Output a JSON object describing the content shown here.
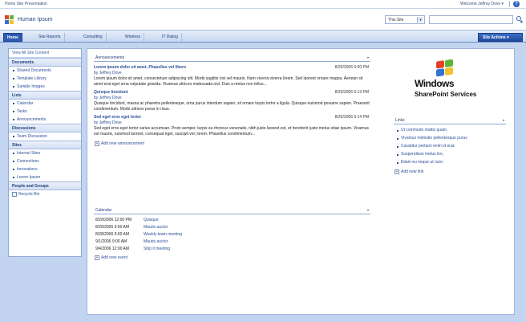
{
  "topbar": {
    "site_link": "Home Site Presentation",
    "welcome": "Welcome Jeffrey Dove ▾"
  },
  "header": {
    "site_title": "Human Ipsum",
    "search_scope": "This Site",
    "search_placeholder": ""
  },
  "nav": {
    "tabs": [
      {
        "label": "Home",
        "active": true
      },
      {
        "label": "Site Reports",
        "active": false
      },
      {
        "label": "Consulting",
        "active": false
      },
      {
        "label": "Wireless",
        "active": false
      },
      {
        "label": "IT Dialog",
        "active": false
      }
    ],
    "site_actions": "Site Actions ▾"
  },
  "leftnav": {
    "view_all": "View All Site Content",
    "sections": [
      {
        "heading": "Documents",
        "items": [
          "Shared Documents",
          "Template Library",
          "Sample Images"
        ]
      },
      {
        "heading": "Lists",
        "items": [
          "Calendar",
          "Tasks",
          "Announcements"
        ]
      },
      {
        "heading": "Discussions",
        "items": [
          "Team Discussion"
        ]
      },
      {
        "heading": "Sites",
        "items": [
          "Internal Sites",
          "Connections",
          "Innovations",
          "Lorem Ipsum"
        ]
      },
      {
        "heading": "People and Groups",
        "items": []
      }
    ],
    "recycle_bin": "Recycle Bin"
  },
  "announcements": {
    "title": "Announcements",
    "menu": "▾",
    "items": [
      {
        "title": "Lorem ipsum dolor sit amet, Phasellus vel libero",
        "date": "8/20/2006 5:00 PM",
        "by": "by Jeffrey Dove",
        "body": "Lorem ipsum dolor sit amet, consectetuer adipiscing elit. Morbi sagittis nisi vel mauris. Nam viverra viverra lorem. Sed laoreet ornare magna. Aenean sit amet erat eget urna vulputate gravida. Vivamus ultrices malesuada nisl. Duis a metus non tellus..."
      },
      {
        "title": "Quisque tincidunt",
        "date": "8/20/2006 5:13 PM",
        "by": "by Jeffrey Dove",
        "body": "Quisque tincidunt, massa ac pharetra pellentesque, urna purus interdum sapien, sit ornare turpis tortor a ligula. Quisque euismod posuere sapien. Praesent condimentum. Morbi ultrices purus in risus."
      },
      {
        "title": "Sed eget eros eget tortor",
        "date": "8/20/2006 5:14 PM",
        "by": "by Jeffrey Dove",
        "body": "Sed eget eros eget tortor varius accumsan. Proin semper, turpis eu rhoncus venenatis, nibh justo laoreet est, et hendrerit justo metus vitae ipsum. Vivamus est mauris, euismod laoreet, consequat eget, suscipit vel, lorem. Phasellus condimentum..."
      }
    ],
    "add_new": "Add new announcement"
  },
  "calendar": {
    "title": "Calendar",
    "menu": "▾",
    "events": [
      {
        "date": "8/20/2006 12:00 PM",
        "title": "Quisque"
      },
      {
        "date": "8/26/2006 9:00 AM",
        "title": "Mauris auctor"
      },
      {
        "date": "8/28/2006 9:00 AM",
        "title": "Weekly team meeting"
      },
      {
        "date": "9/1/2006 9:00 AM",
        "title": "Mauris auctor"
      },
      {
        "date": "9/4/2006 12:00 AM",
        "title": "Ship it meeting"
      }
    ],
    "add_new": "Add new event"
  },
  "brand": {
    "windows": "Windows",
    "product": "SharePoint Services",
    "colors": {
      "red": "#e5412a",
      "green": "#5fb53a",
      "blue": "#2f74d0",
      "yellow": "#f6c02b"
    }
  },
  "links": {
    "title": "Links",
    "menu": "▾",
    "items": [
      "Ut commodo mattis quam.",
      "Vivamus molestie pellentesque purus",
      "Curabitur pretium enim id erat.",
      "Suspendisse metus leo,",
      "Etiam eu neque ut nunc"
    ],
    "add_new": "Add new link"
  }
}
